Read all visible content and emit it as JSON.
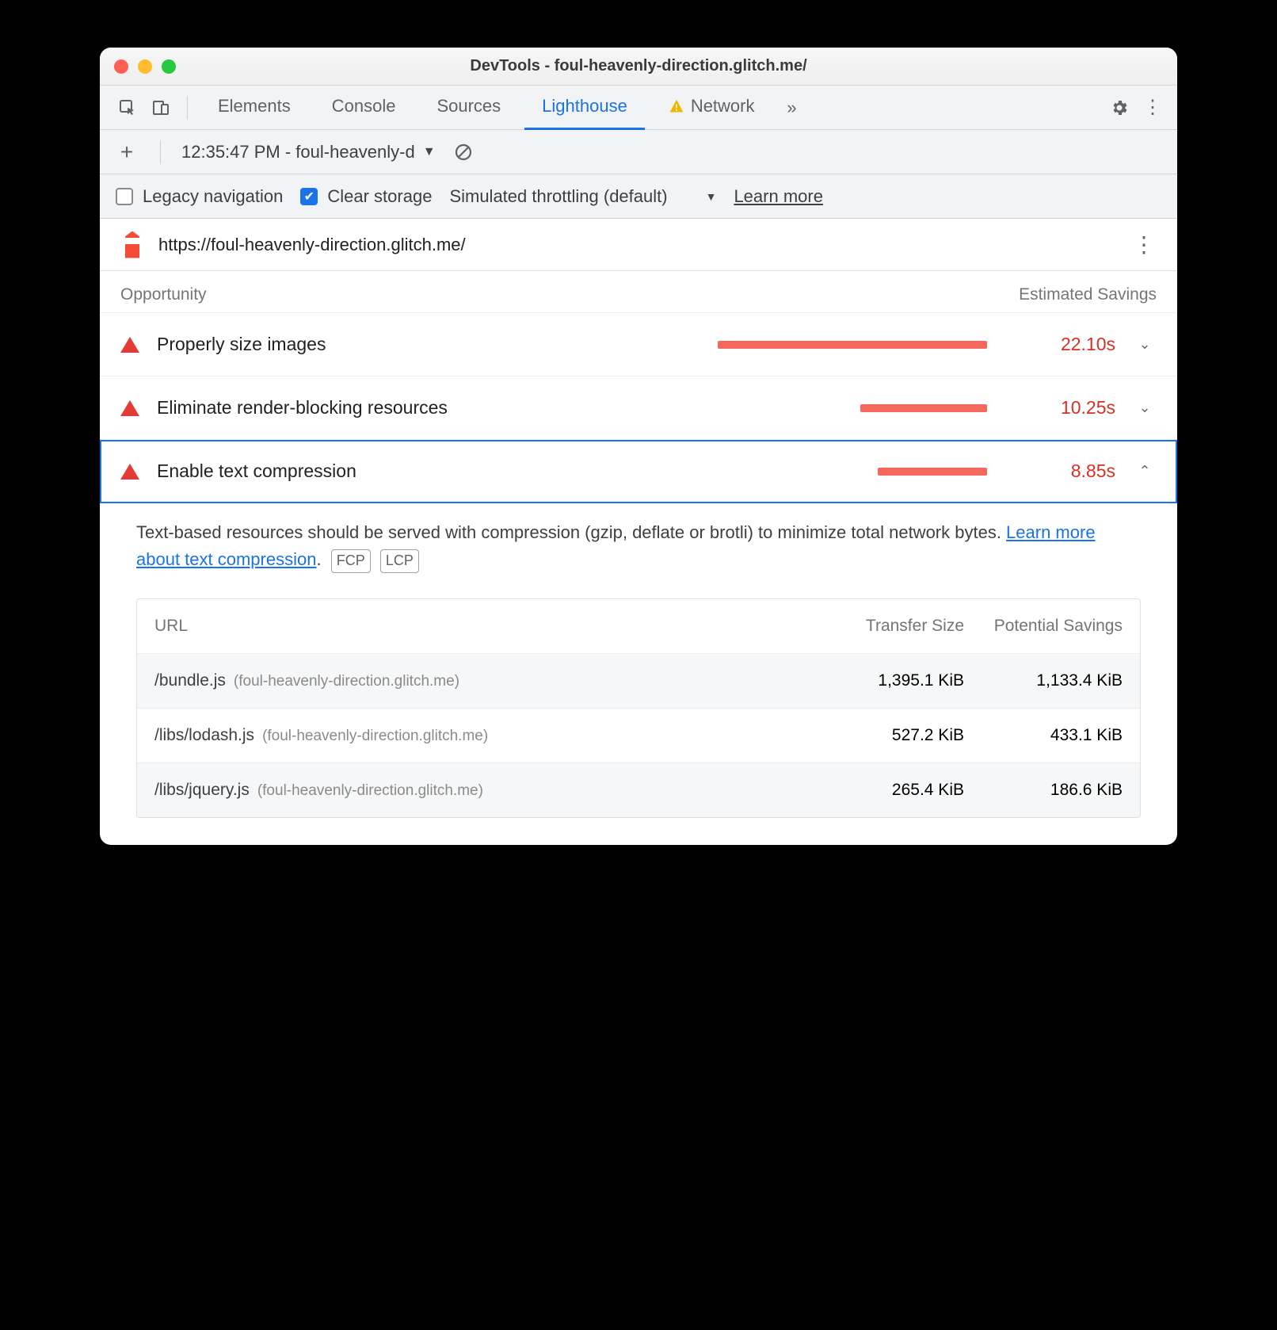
{
  "window": {
    "title": "DevTools - foul-heavenly-direction.glitch.me/"
  },
  "tabs": {
    "items": [
      "Elements",
      "Console",
      "Sources",
      "Lighthouse",
      "Network"
    ],
    "active": "Lighthouse",
    "network_warning": true
  },
  "toolbar": {
    "report_label": "12:35:47 PM - foul-heavenly-d"
  },
  "options": {
    "legacy_label": "Legacy navigation",
    "legacy_checked": false,
    "clear_label": "Clear storage",
    "clear_checked": true,
    "throttle_label": "Simulated throttling (default)",
    "learn_more": "Learn more"
  },
  "report": {
    "url": "https://foul-heavenly-direction.glitch.me/",
    "headers": {
      "opportunity": "Opportunity",
      "savings": "Estimated Savings"
    },
    "opportunities": [
      {
        "label": "Properly size images",
        "time": "22.10s",
        "bar_pct": 100,
        "expanded": false
      },
      {
        "label": "Eliminate render-blocking resources",
        "time": "10.25s",
        "bar_pct": 46,
        "expanded": false
      },
      {
        "label": "Enable text compression",
        "time": "8.85s",
        "bar_pct": 40,
        "expanded": true
      }
    ],
    "detail": {
      "text_a": "Text-based resources should be served with compression (gzip, deflate or brotli) to minimize total network bytes. ",
      "link": "Learn more about text compression",
      "badges": [
        "FCP",
        "LCP"
      ],
      "table": {
        "head": {
          "url": "URL",
          "size": "Transfer Size",
          "savings": "Potential Savings"
        },
        "rows": [
          {
            "path": "/bundle.js",
            "host": "(foul-heavenly-direction.glitch.me)",
            "size": "1,395.1 KiB",
            "savings": "1,133.4 KiB"
          },
          {
            "path": "/libs/lodash.js",
            "host": "(foul-heavenly-direction.glitch.me)",
            "size": "527.2 KiB",
            "savings": "433.1 KiB"
          },
          {
            "path": "/libs/jquery.js",
            "host": "(foul-heavenly-direction.glitch.me)",
            "size": "265.4 KiB",
            "savings": "186.6 KiB"
          }
        ]
      }
    }
  }
}
